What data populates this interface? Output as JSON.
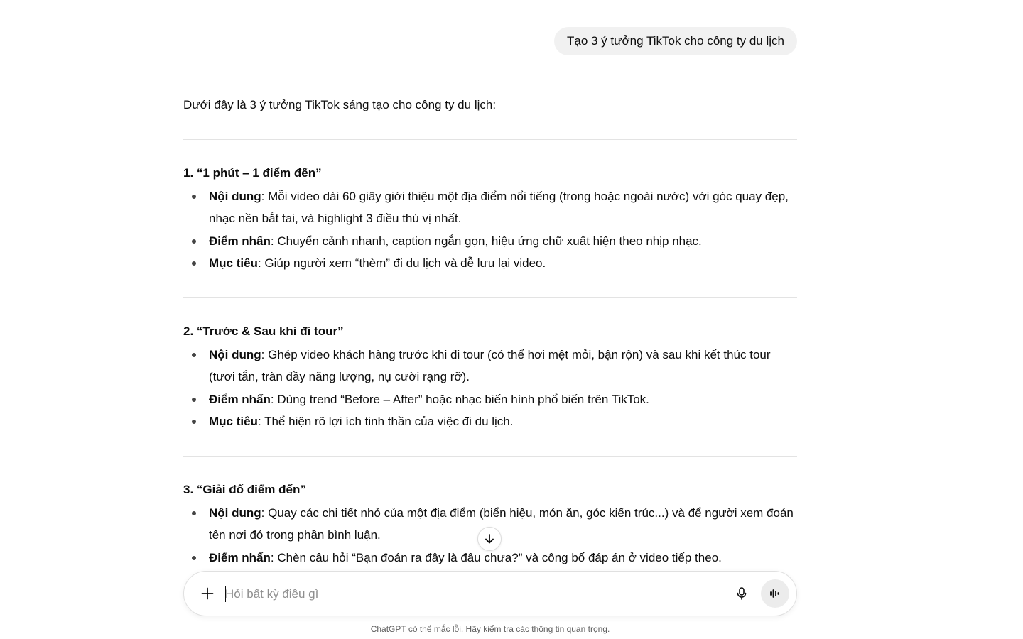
{
  "user_message": "Tạo 3 ý tưởng TikTok cho công ty du lịch",
  "assistant": {
    "intro": "Dưới đây là 3 ý tưởng TikTok sáng tạo cho công ty du lịch:",
    "sections": [
      {
        "title": "1. “1 phút – 1 điểm đến”",
        "items": [
          {
            "label": "Nội dung",
            "text": ": Mỗi video dài 60 giây giới thiệu một địa điểm nổi tiếng (trong hoặc ngoài nước) với góc quay đẹp, nhạc nền bắt tai, và highlight 3 điều thú vị nhất."
          },
          {
            "label": "Điểm nhấn",
            "text": ": Chuyển cảnh nhanh, caption ngắn gọn, hiệu ứng chữ xuất hiện theo nhịp nhạc."
          },
          {
            "label": "Mục tiêu",
            "text": ": Giúp người xem “thèm” đi du lịch và dễ lưu lại video."
          }
        ]
      },
      {
        "title": "2. “Trước & Sau khi đi tour”",
        "items": [
          {
            "label": "Nội dung",
            "text": ": Ghép video khách hàng trước khi đi tour (có thể hơi mệt mỏi, bận rộn) và sau khi kết thúc tour (tươi tắn, tràn đầy năng lượng, nụ cười rạng rỡ)."
          },
          {
            "label": "Điểm nhấn",
            "text": ": Dùng trend “Before – After” hoặc nhạc biến hình phổ biến trên TikTok."
          },
          {
            "label": "Mục tiêu",
            "text": ": Thể hiện rõ lợi ích tinh thần của việc đi du lịch."
          }
        ]
      },
      {
        "title": "3. “Giải đố điểm đến”",
        "items": [
          {
            "label": "Nội dung",
            "text": ": Quay các chi tiết nhỏ của một địa điểm (biển hiệu, món ăn, góc kiến trúc...) và để người xem đoán tên nơi đó trong phần bình luận."
          },
          {
            "label": "Điểm nhấn",
            "text": ": Chèn câu hỏi “Bạn đoán ra đây là đâu chưa?” và công bố đáp án ở video tiếp theo."
          }
        ]
      }
    ]
  },
  "composer": {
    "placeholder": "Hỏi bất kỳ điều gì",
    "value": ""
  },
  "icons": {
    "plus": "plus-icon",
    "mic": "microphone-icon",
    "voice": "voice-mode-icon",
    "scroll": "arrow-down-icon"
  },
  "disclaimer": "ChatGPT có thể mắc lỗi. Hãy kiểm tra các thông tin quan trọng."
}
